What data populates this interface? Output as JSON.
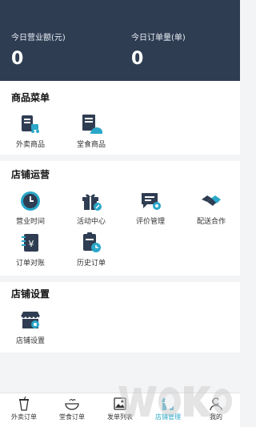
{
  "header": {
    "revenue_label": "今日营业额(元)",
    "revenue_value": "0",
    "orders_label": "今日订单量(单)",
    "orders_value": "0"
  },
  "menu_section": {
    "title": "商品菜单",
    "items": [
      {
        "label": "外卖商品",
        "icon": "delivery-product-icon"
      },
      {
        "label": "堂食商品",
        "icon": "dine-in-product-icon"
      }
    ]
  },
  "ops_section": {
    "title": "店铺运营",
    "items": [
      {
        "label": "营业时间",
        "icon": "clock-icon"
      },
      {
        "label": "活动中心",
        "icon": "gift-icon"
      },
      {
        "label": "评价管理",
        "icon": "review-icon"
      },
      {
        "label": "配送合作",
        "icon": "handshake-icon"
      },
      {
        "label": "订单对账",
        "icon": "yen-ledger-icon"
      },
      {
        "label": "历史订单",
        "icon": "order-history-icon"
      }
    ]
  },
  "settings_section": {
    "title": "店铺设置",
    "items": [
      {
        "label": "店铺设置",
        "icon": "store-settings-icon"
      }
    ]
  },
  "tabbar": {
    "active_index": 3,
    "accent_color": "#2aa7c9",
    "items": [
      {
        "label": "外卖订单",
        "icon": "takeout-cup-icon"
      },
      {
        "label": "堂食订单",
        "icon": "bowl-icon"
      },
      {
        "label": "发单列表",
        "icon": "list-image-icon"
      },
      {
        "label": "店铺管理",
        "icon": "shop-icon"
      },
      {
        "label": "我的",
        "icon": "profile-icon"
      }
    ]
  },
  "colors": {
    "header_bg": "#2f3d52",
    "icon_dark": "#2f3d52",
    "icon_accent": "#2aa7c9"
  }
}
